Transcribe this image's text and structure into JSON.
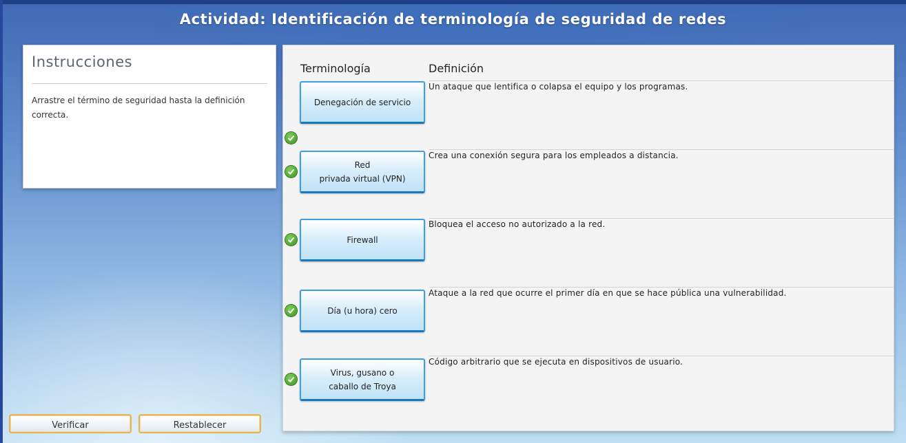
{
  "activity": {
    "title": "Actividad: Identificación de terminología de seguridad de redes"
  },
  "instructions": {
    "heading": "Instrucciones",
    "text": "Arrastre el término de seguridad hasta la definición correcta."
  },
  "table": {
    "term_header": "Terminología",
    "definition_header": "Definición",
    "rows": [
      {
        "term": "Denegación de servicio",
        "definition": "Un ataque que lentifica o colapsa el equipo y los programas.",
        "status_icon": "check-circle-icon"
      },
      {
        "term": "Red\nprivada virtual (VPN)",
        "definition": "Crea una conexión segura para los empleados a distancia.",
        "status_icon": "check-circle-icon"
      },
      {
        "term": "Firewall",
        "definition": "Bloquea el acceso no autorizado a la red.",
        "status_icon": "check-circle-icon"
      },
      {
        "term": "Día (u hora) cero",
        "definition": "Ataque a la red que ocurre el primer día en que se hace pública una vulnerabilidad.",
        "status_icon": "check-circle-icon"
      },
      {
        "term": "Virus, gusano o\ncaballo de Troya",
        "definition": "Código arbitrario que se ejecuta en dispositivos de usuario.",
        "status_icon": "check-circle-icon"
      }
    ]
  },
  "buttons": {
    "verify_label": "Verificar",
    "reset_label": "Restablecer"
  },
  "colors": {
    "accent_border": "#3aa0e0",
    "check_green": "#3b8f1d",
    "button_border": "#e7b256"
  }
}
